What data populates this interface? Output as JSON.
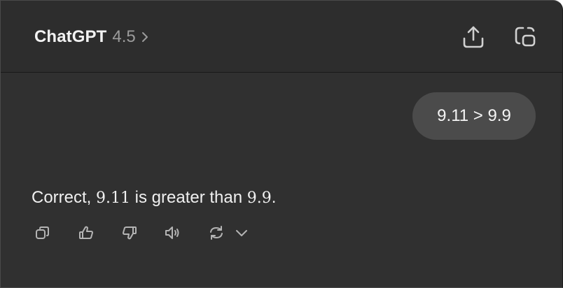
{
  "header": {
    "brand": "ChatGPT",
    "model_version": "4.5",
    "icons": {
      "model_chevron": "chevron-right-icon",
      "share": "share-icon",
      "new_chat": "new-chat-icon"
    }
  },
  "conversation": {
    "user_message": "9.11 > 9.9",
    "assistant_message": {
      "prefix": "Correct, ",
      "value_a": "9.11",
      "middle": " is greater than ",
      "value_b": "9.9",
      "suffix": "."
    }
  },
  "message_actions": [
    {
      "icon": "copy-icon"
    },
    {
      "icon": "thumbs-up-icon"
    },
    {
      "icon": "thumbs-down-icon"
    },
    {
      "icon": "read-aloud-icon"
    },
    {
      "icon": "regenerate-icon"
    },
    {
      "icon": "chevron-down-icon"
    }
  ],
  "colors": {
    "window_bg": "#303030",
    "header_bg": "#2d2d2d",
    "user_bubble_bg": "#4b4b4b",
    "text_primary": "#ececec",
    "text_secondary": "#9b9b9b",
    "icon": "#b4b4b4"
  }
}
